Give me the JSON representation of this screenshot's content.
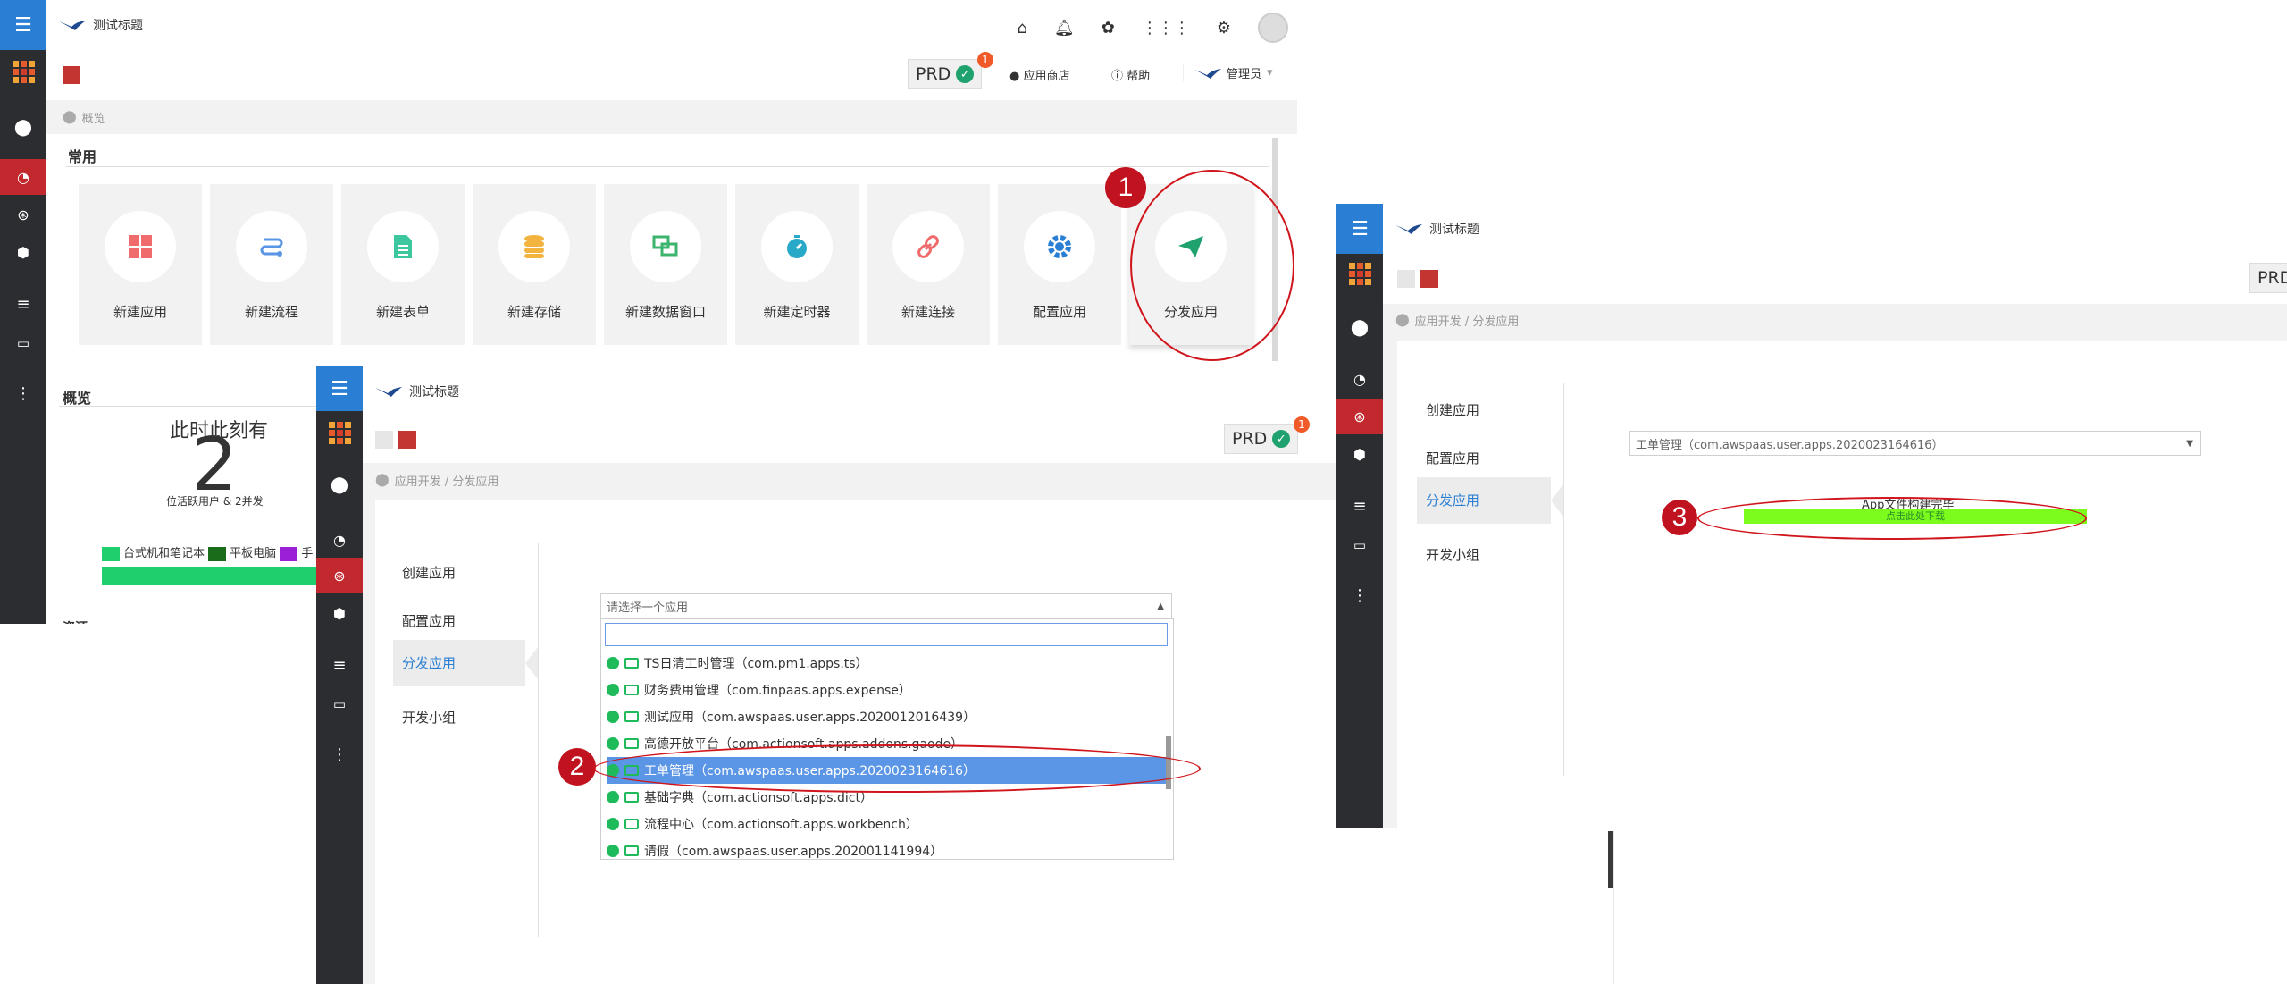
{
  "app": {
    "title": "测试标题",
    "env": "PRD",
    "notif_count": "1"
  },
  "header": {
    "app_store": "应用商店",
    "help": "帮助",
    "user": "管理员"
  },
  "overview": {
    "breadcrumb": "概览",
    "common_title": "常用",
    "tiles": [
      {
        "label": "新建应用",
        "icon": "grid-icon",
        "color": "#f06b6b"
      },
      {
        "label": "新建流程",
        "icon": "flow-icon",
        "color": "#5b95e5"
      },
      {
        "label": "新建表单",
        "icon": "form-icon",
        "color": "#3cc79e"
      },
      {
        "label": "新建存储",
        "icon": "database-icon",
        "color": "#f3b43f"
      },
      {
        "label": "新建数据窗口",
        "icon": "window-icon",
        "color": "#3cb46e"
      },
      {
        "label": "新建定时器",
        "icon": "timer-icon",
        "color": "#27a9c7"
      },
      {
        "label": "新建连接",
        "icon": "link-icon",
        "color": "#f06b6b"
      },
      {
        "label": "配置应用",
        "icon": "gear-icon",
        "color": "#2a7fd4"
      },
      {
        "label": "分发应用",
        "icon": "send-icon",
        "color": "#1fa26e"
      }
    ],
    "summary_title": "概览",
    "active_heading": "此时此刻有",
    "active_count": "2",
    "active_sub": "位活跃用户 & 2并发",
    "legend": [
      {
        "label": "台式机和笔记本",
        "color": "#1fce6d"
      },
      {
        "label": "平板电脑",
        "color": "#1a6b1a"
      },
      {
        "label": "手",
        "color": "#9b1fd6"
      }
    ],
    "bottom_title": "资源"
  },
  "publish": {
    "breadcrumb": "应用开发 / 分发应用",
    "nav": [
      "创建应用",
      "配置应用",
      "分发应用",
      "开发小组"
    ],
    "select_placeholder": "请选择一个应用",
    "options": [
      {
        "label": "TS日清工时管理（com.pm1.apps.ts）",
        "kind": "pc"
      },
      {
        "label": "财务费用管理（com.finpaas.apps.expense）",
        "kind": "pc"
      },
      {
        "label": "测试应用（com.awspaas.user.apps.2020012016439）",
        "kind": "hybrid"
      },
      {
        "label": "高德开放平台（com.actionsoft.apps.addons.gaode）",
        "kind": "pc"
      },
      {
        "label": "工单管理（com.awspaas.user.apps.2020023164616）",
        "kind": "hybrid"
      },
      {
        "label": "基础字典（com.actionsoft.apps.dict）",
        "kind": "pc"
      },
      {
        "label": "流程中心（com.actionsoft.apps.workbench）",
        "kind": "pc"
      },
      {
        "label": "请假（com.awspaas.user.apps.202001141994）",
        "kind": "hybrid"
      }
    ],
    "selected_index": 4
  },
  "result": {
    "breadcrumb": "应用开发 / 分发应用",
    "selected_app": "工单管理（com.awspaas.user.apps.2020023164616）",
    "build_done": "App文件构建完毕",
    "download": "点击此处下载",
    "env_partial": "PRD"
  },
  "callouts": [
    "1",
    "2",
    "3"
  ]
}
